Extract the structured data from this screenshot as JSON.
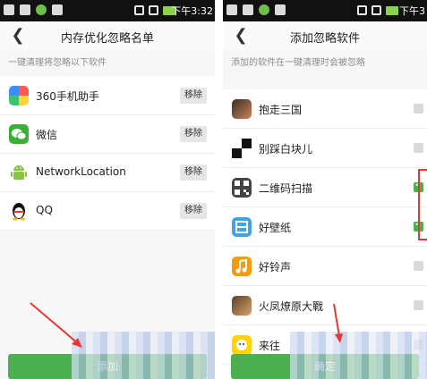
{
  "left_screen": {
    "status_time": "下午3:32",
    "title": "内存优化忽略名单",
    "hint": "一键清理将忽略以下软件",
    "apps": [
      {
        "name": "360手机助手",
        "action": "移除",
        "icon": "360-assistant-icon"
      },
      {
        "name": "微信",
        "action": "移除",
        "icon": "wechat-icon"
      },
      {
        "name": "NetworkLocation",
        "action": "移除",
        "icon": "android-icon"
      },
      {
        "name": "QQ",
        "action": "移除",
        "icon": "qq-penguin-icon"
      }
    ],
    "bottom_button": "添加"
  },
  "right_screen": {
    "status_time": "下午3",
    "title": "添加忽略软件",
    "hint": "添加的软件在一键清理时会被忽略",
    "apps": [
      {
        "name": "抱走三国",
        "checked": false,
        "icon": "sanguo-game-icon"
      },
      {
        "name": "别踩白块儿",
        "checked": false,
        "icon": "piano-tiles-icon"
      },
      {
        "name": "二维码扫描",
        "checked": true,
        "icon": "qr-code-icon"
      },
      {
        "name": "好壁纸",
        "checked": true,
        "icon": "wallpaper-icon"
      },
      {
        "name": "好铃声",
        "checked": false,
        "icon": "music-note-icon"
      },
      {
        "name": "火凤燎原大戰",
        "checked": false,
        "icon": "phoenix-game-icon"
      },
      {
        "name": "来往",
        "checked": false,
        "icon": "laiwang-icon"
      }
    ],
    "bottom_button": "确定"
  },
  "colors": {
    "accent_green": "#4caf50",
    "highlight_red": "#e53935",
    "status_bar": "#111111"
  }
}
